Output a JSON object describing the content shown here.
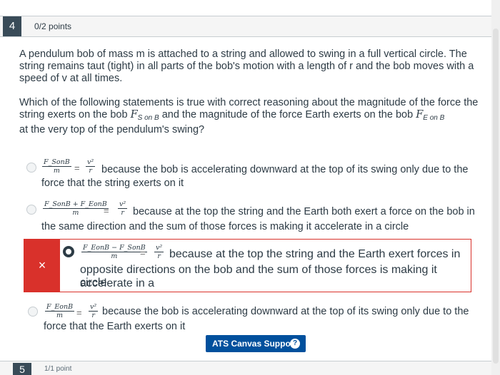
{
  "question": {
    "number": "4",
    "points": "0/2 points",
    "stem": "A pendulum bob of mass m is attached to a string and allowed to swing in a full vertical circle. The string remains taut (tight) in all parts of the bob's motion with a length of r and the bob moves with a speed of v at all times.",
    "prompt_a": "Which of the following statements is true with correct reasoning about the magnitude of the force the string exerts on the bob ",
    "prompt_f1": "F",
    "prompt_f1_sub": "S on B",
    "prompt_b": " and the magnitude of the force Earth exerts on the bob ",
    "prompt_f2": "F",
    "prompt_f2_sub": "E on B",
    "prompt_c": "at the very top of the pendulum's swing?"
  },
  "answers": [
    {
      "num": "F_SonB",
      "den": "m",
      "rhs_num": "v²",
      "rhs_den": "r",
      "line1": "because the bob is accelerating downward at the top of its swing only due to the",
      "line2": "force that the string exerts on it"
    },
    {
      "num": "F_SonB + F_EonB",
      "den": "m",
      "rhs_num": "v²",
      "rhs_den": "r",
      "line1": "because at the top the string and the Earth both exert a force on the bob in",
      "line2": "the same direction and the sum of those forces is making it accelerate in a circle"
    },
    {
      "num": "F_EonB − F_SonB",
      "den": "m",
      "rhs_num": "v²",
      "rhs_den": "r",
      "line1": "because at the top the string and the Earth exert forces in",
      "line2": "opposite directions on the bob and the sum of those forces is making it accelerate in a",
      "line3": "circle",
      "marker": "×"
    },
    {
      "num": "F_EonB",
      "den": "m",
      "rhs_num": "v²",
      "rhs_den": "r",
      "line1": "because the bob is accelerating downward at the top of its swing only due to the",
      "line2": "force that the Earth exerts on it"
    }
  ],
  "equals": "=",
  "support_button": {
    "label": "ATS Canvas Support",
    "icon": "?"
  },
  "next_question": {
    "number": "5",
    "points": "1/1 point"
  }
}
